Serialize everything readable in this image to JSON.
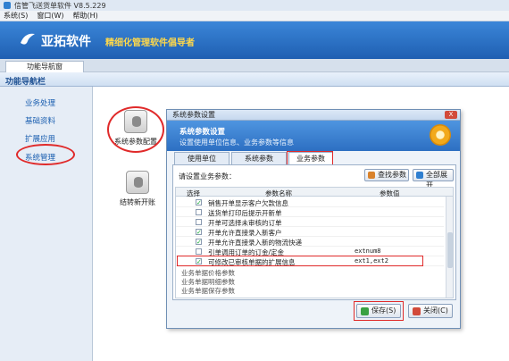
{
  "app": {
    "title": "信管飞送货单软件 V8.5.229",
    "brand": "亚拓软件",
    "slogan": "精细化管理软件倡导者"
  },
  "menu": [
    "系统(S)",
    "窗口(W)",
    "帮助(H)"
  ],
  "tab": {
    "label": "功能导航窗"
  },
  "nav": {
    "header": "功能导航栏"
  },
  "sidebar": {
    "items": [
      "业务处理",
      "基础资料",
      "扩展应用",
      "系统管理"
    ]
  },
  "modules": [
    {
      "label": "系统参数配置"
    },
    {
      "label": "结转新开账"
    }
  ],
  "dialog": {
    "title": "系统参数设置",
    "close_label": "X",
    "heading": "系统参数设置",
    "subheading": "设置使用单位信息、业务参数等信息",
    "tabs": [
      "使用单位",
      "系统参数",
      "业务参数"
    ],
    "prompt": "请设置业务参数：",
    "find_button": "查找参数",
    "expand_button": "全部展开",
    "columns": [
      "选择",
      "参数名称",
      "参数值"
    ],
    "rows": [
      {
        "checked": "✓",
        "name": "销售开单显示客户欠款信息",
        "value": ""
      },
      {
        "checked": "",
        "name": "送货单打印后提示开新单",
        "value": ""
      },
      {
        "checked": "",
        "name": "开单可选择未审核的订单",
        "value": ""
      },
      {
        "checked": "✓",
        "name": "开单允许直接录入新客户",
        "value": ""
      },
      {
        "checked": "✓",
        "name": "开单允许直接录入新的物流快递",
        "value": ""
      },
      {
        "checked": "",
        "name": "引单调用订单的订金/定金",
        "value": "extnum8"
      },
      {
        "checked": "✓",
        "name": "可修改已审核单据的扩展信息",
        "value": "ext1,ext2"
      }
    ],
    "groups": [
      "业务单据价格参数",
      "业务单据明细参数",
      "业务单据保存参数"
    ],
    "save_button": "保存(S)",
    "close_button": "关闭(C)"
  }
}
